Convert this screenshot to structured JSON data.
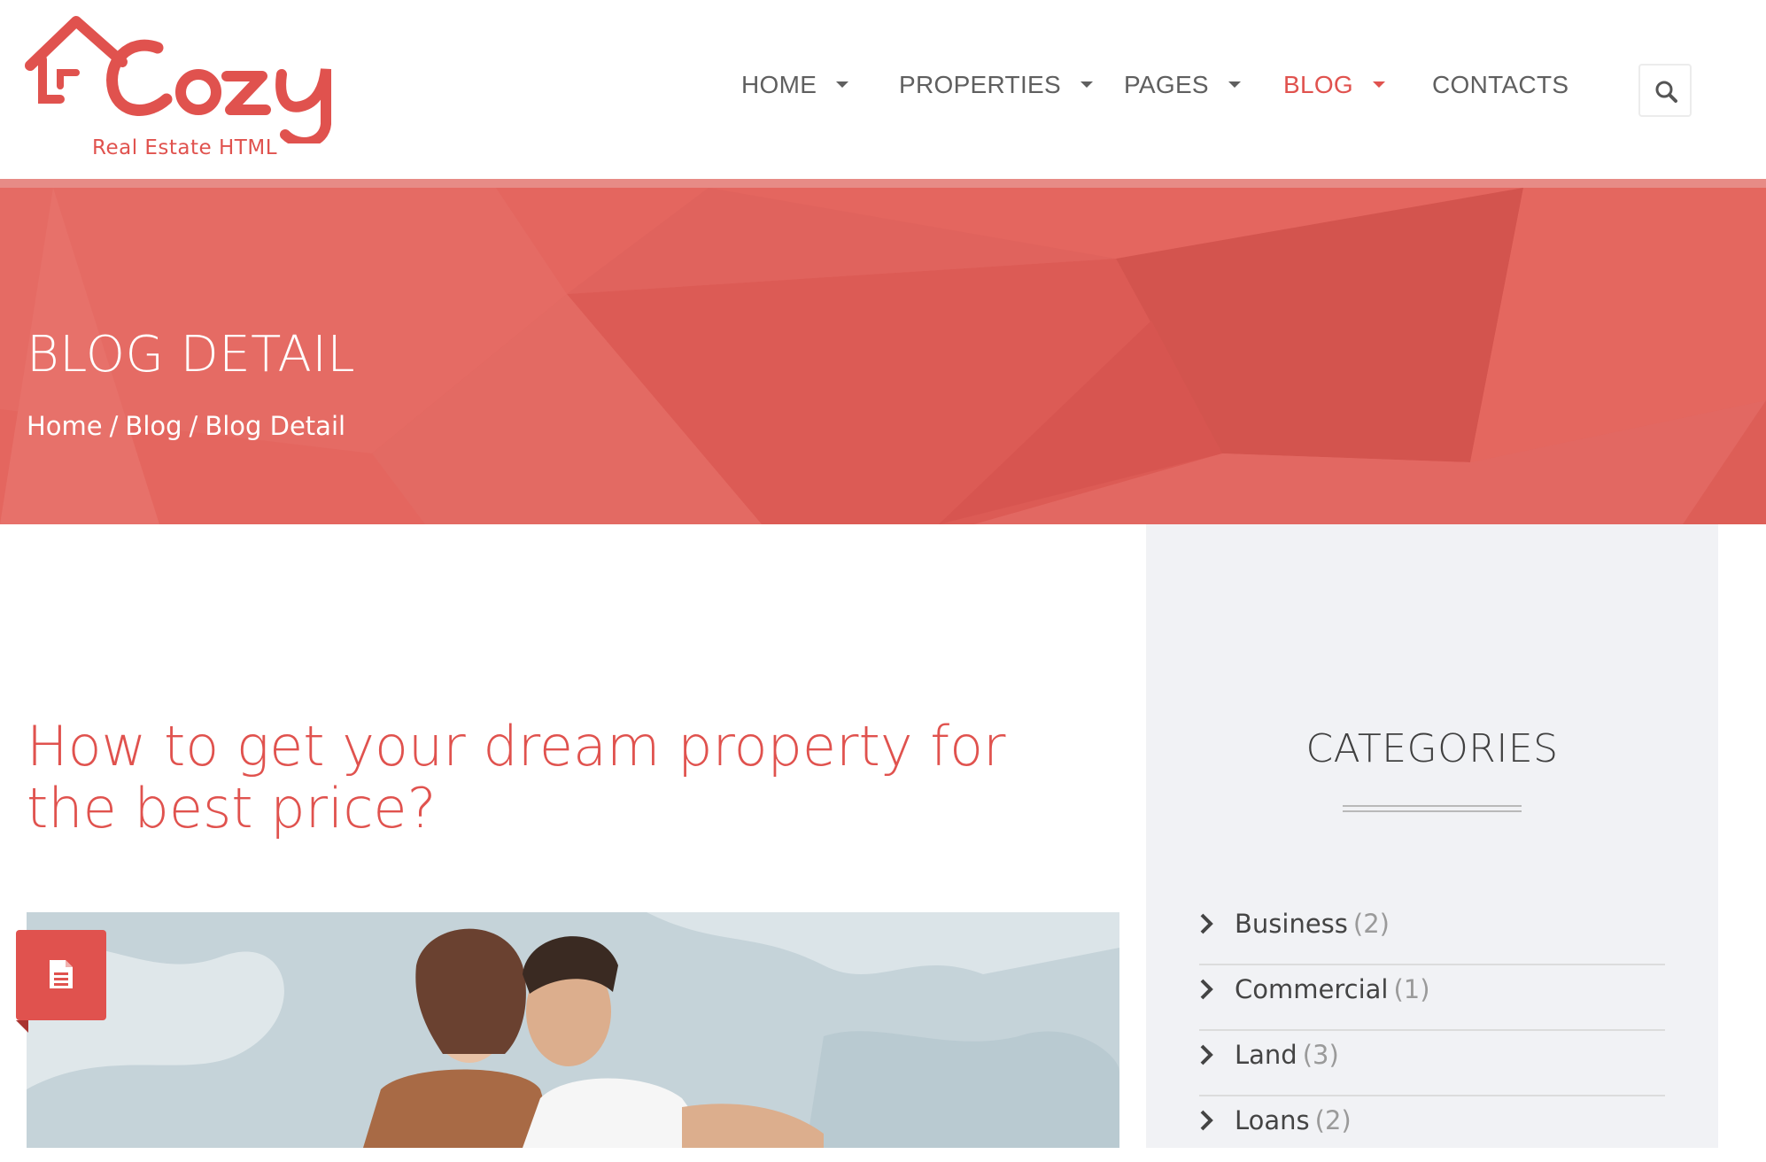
{
  "brand": {
    "name": "Cozy",
    "tagline": "Real Estate HTML",
    "accent_color": "#e0524e"
  },
  "nav": {
    "items": [
      {
        "label": "HOME",
        "has_dropdown": true,
        "active": false
      },
      {
        "label": "PROPERTIES",
        "has_dropdown": true,
        "active": false
      },
      {
        "label": "PAGES",
        "has_dropdown": true,
        "active": false
      },
      {
        "label": "BLOG",
        "has_dropdown": true,
        "active": true
      },
      {
        "label": "CONTACTS",
        "has_dropdown": false,
        "active": false
      }
    ],
    "search_icon": "search-icon"
  },
  "banner": {
    "title": "BLOG DETAIL",
    "breadcrumb": [
      "Home",
      "Blog",
      "Blog Detail"
    ],
    "separator": "/"
  },
  "post": {
    "title": "How to get your dream property for the best price?",
    "badge_icon": "document-icon"
  },
  "sidebar": {
    "title": "CATEGORIES",
    "categories": [
      {
        "label": "Business",
        "count": "(2)"
      },
      {
        "label": "Commercial",
        "count": "(1)"
      },
      {
        "label": "Land",
        "count": "(3)"
      },
      {
        "label": "Loans",
        "count": "(2)"
      }
    ]
  }
}
